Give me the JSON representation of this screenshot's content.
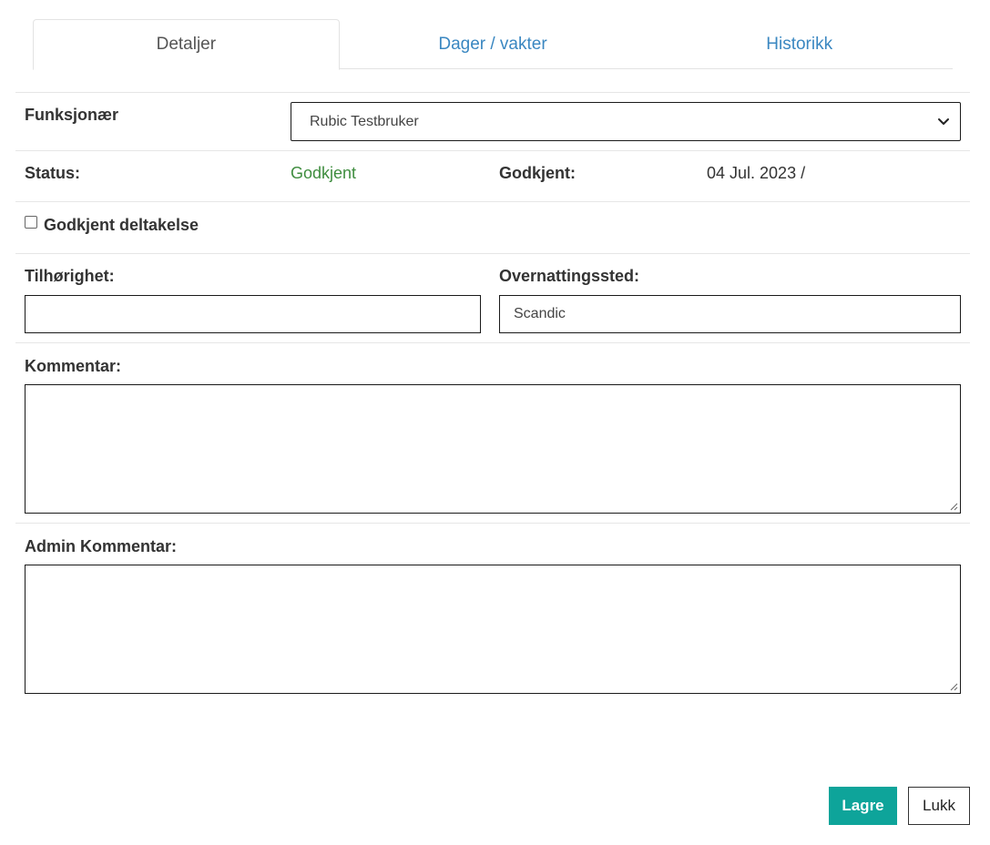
{
  "tabs": [
    {
      "label": "Detaljer",
      "active": true
    },
    {
      "label": "Dager / vakter",
      "active": false
    },
    {
      "label": "Historikk",
      "active": false
    }
  ],
  "funksjonaer": {
    "label": "Funksjonær",
    "selected": "Rubic Testbruker"
  },
  "status": {
    "label": "Status:",
    "value": "Godkjent",
    "value_color": "#3f8d3f"
  },
  "godkjent": {
    "label": "Godkjent:",
    "value": "04 Jul. 2023 /"
  },
  "deltakelse": {
    "label": "Godkjent deltakelse",
    "checked": false
  },
  "tilhorighet": {
    "label": "Tilhørighet:",
    "value": ""
  },
  "overnatting": {
    "label": "Overnattingssted:",
    "value": "Scandic"
  },
  "kommentar": {
    "label": "Kommentar:",
    "value": ""
  },
  "admin_kommentar": {
    "label": "Admin Kommentar:",
    "value": ""
  },
  "buttons": {
    "save": "Lagre",
    "close": "Lukk"
  },
  "colors": {
    "accent": "#0ea49a",
    "link": "#3a87c1"
  },
  "icons": {
    "select_arrow": "chevron-down-icon",
    "resize": "resize-grip-icon"
  }
}
